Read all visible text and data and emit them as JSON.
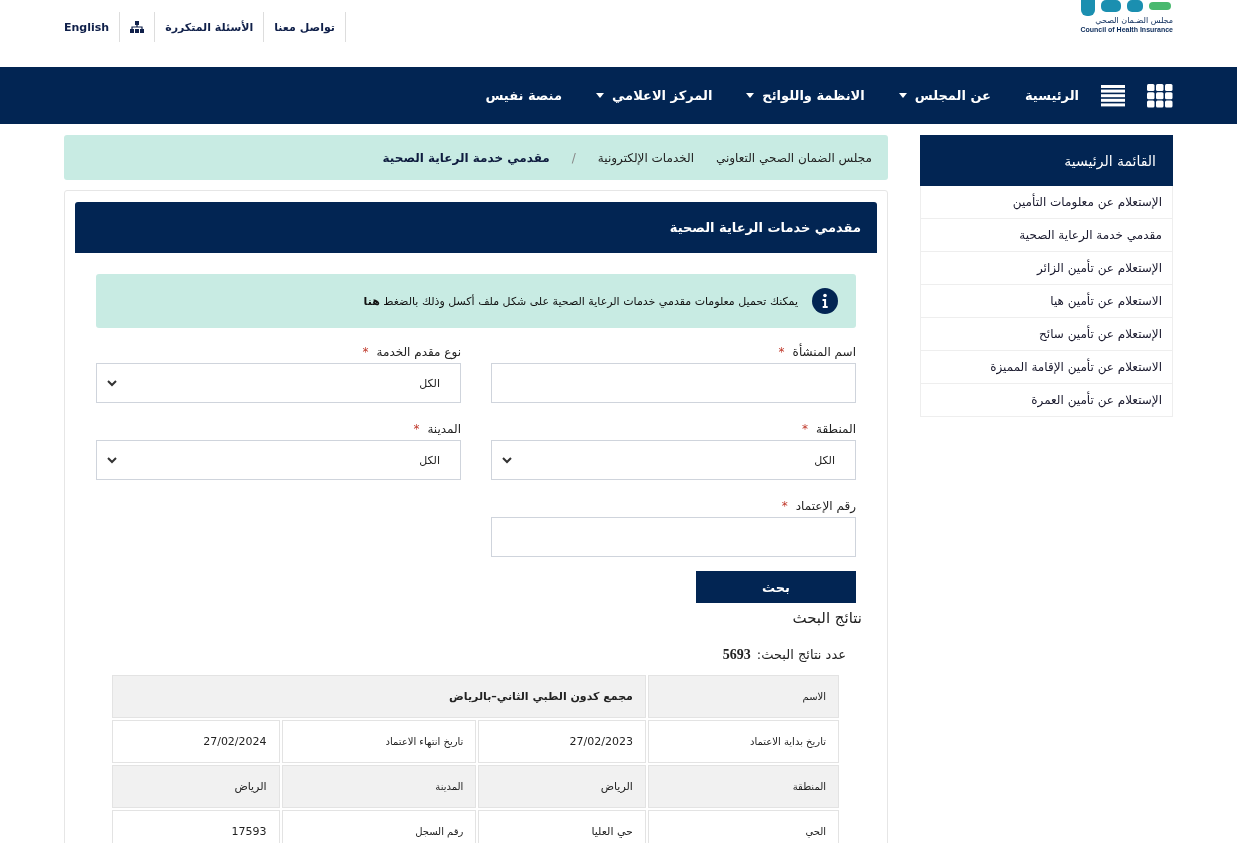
{
  "header": {
    "logo": {
      "name_ar": "مجلس الضـمان الصحي",
      "name_en": "Council of Health Insurance"
    },
    "top_links": [
      {
        "kind": "text",
        "label": "تواصل معنا"
      },
      {
        "kind": "text",
        "label": "الأسئلة المتكررة"
      },
      {
        "kind": "icon"
      },
      {
        "kind": "text",
        "label": "English"
      }
    ]
  },
  "nav": {
    "items": [
      {
        "label": "الرئيسية",
        "has_menu": false
      },
      {
        "label": "عن المجلس",
        "has_menu": true
      },
      {
        "label": "الانظمة واللوائح",
        "has_menu": true
      },
      {
        "label": "المركز الاعلامي",
        "has_menu": true
      },
      {
        "label": "منصة نفيس",
        "has_menu": false
      }
    ]
  },
  "breadcrumb": [
    {
      "label": "مجلس الضمان الصحي التعاوني",
      "current": false
    },
    {
      "label": "الخدمات الإلكترونية",
      "current": false
    },
    {
      "label": "مقدمي خدمة الرعاية الصحية",
      "current": true,
      "separator_before": "/"
    }
  ],
  "sidebar": {
    "title": "القائمة الرئيسية",
    "items": [
      "الإستعلام عن معلومات التأمين",
      "مقدمي خدمة الرعاية الصحية",
      "الإستعلام عن تأمين الزائر",
      "الاستعلام عن تأمين هيا",
      "الإستعلام عن تأمين سائح",
      "الاستعلام عن تأمين الإقامة المميزة",
      "الإستعلام عن تأمين العمرة"
    ]
  },
  "panel": {
    "title": "مقدمي خدمات الرعاية الصحية",
    "notice": {
      "text": "يمكنك تحميل معلومات مقدمي خدمات الرعاية الصحية على شكل ملف أكسل وذلك بالضغط",
      "link": "هنا"
    },
    "fields": [
      {
        "kind": "text",
        "label": "اسم المنشأة",
        "required_mark": "*"
      },
      {
        "kind": "select",
        "label": "نوع مقدم الخدمة",
        "required_mark": "*",
        "value": "الكل"
      },
      {
        "kind": "select",
        "label": "المنطقة",
        "required_mark": "*",
        "value": "الكل"
      },
      {
        "kind": "select",
        "label": "المدينة",
        "required_mark": "*",
        "value": "الكل"
      },
      {
        "kind": "text",
        "label": "رقم الإعتماد",
        "required_mark": "*"
      }
    ],
    "search_button": "بحث",
    "results": {
      "title": "نتائج البحث",
      "count_label": "عدد نتائج البحث:",
      "count": "5693",
      "rows": [
        [
          {
            "kind": "label",
            "text": "الاسم"
          },
          {
            "kind": "value",
            "text": "مجمع كدون الطبي الثاني–بالرياض",
            "colspan": 3
          }
        ],
        [
          {
            "kind": "label",
            "text": "تاريخ بداية الاعتماد"
          },
          {
            "kind": "value",
            "text": "27/02/2023"
          },
          {
            "kind": "label",
            "text": "تاريخ انتهاء الاعتماد"
          },
          {
            "kind": "value",
            "text": "27/02/2024"
          }
        ],
        [
          {
            "kind": "label",
            "text": "المنطقة"
          },
          {
            "kind": "value",
            "text": "الرياض"
          },
          {
            "kind": "label",
            "text": "المدينة"
          },
          {
            "kind": "value",
            "text": "الرياض"
          }
        ],
        [
          {
            "kind": "label",
            "text": "الحي"
          },
          {
            "kind": "value",
            "text": "حي العليا"
          },
          {
            "kind": "label",
            "text": "رقم السجل"
          },
          {
            "kind": "value",
            "text": "17593"
          }
        ]
      ]
    }
  }
}
